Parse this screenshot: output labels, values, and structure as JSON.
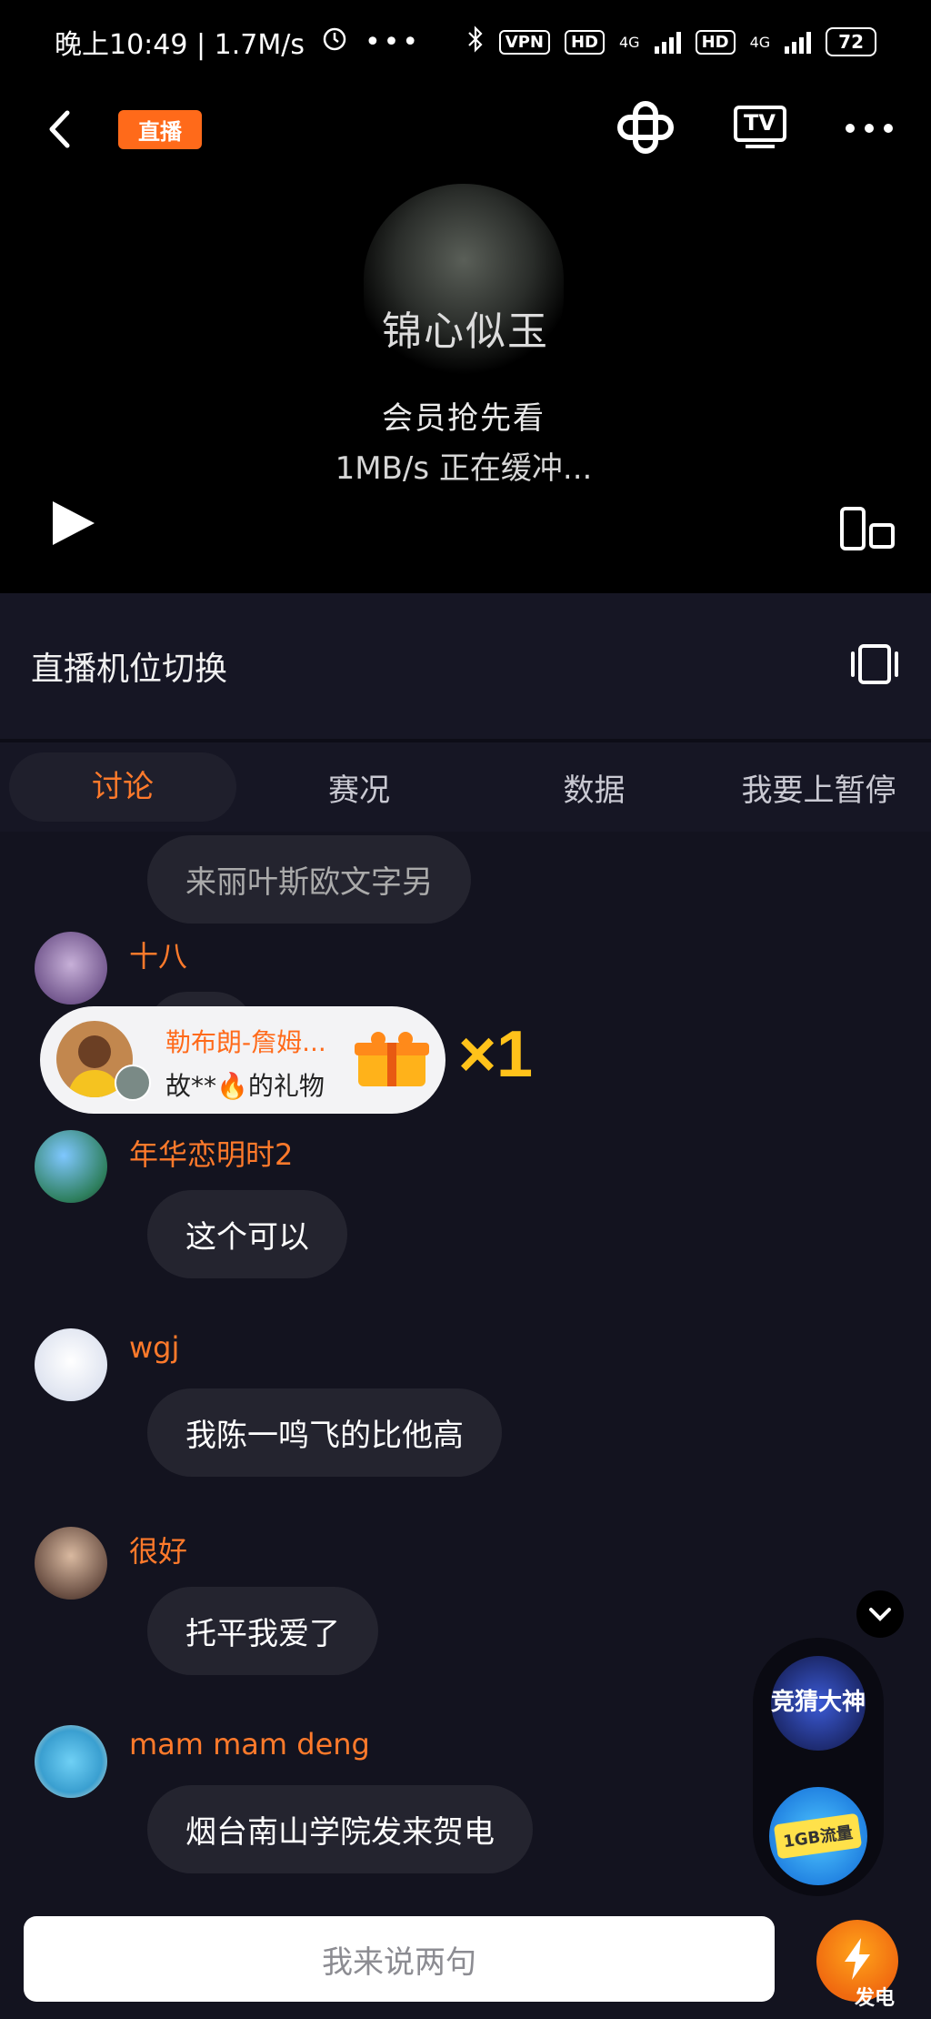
{
  "status": {
    "time": "晚上10:49 | 1.7M/s",
    "vpn": "VPN",
    "hd1": "HD",
    "net1": "4G",
    "hd2": "HD",
    "net2": "4G",
    "battery": "72"
  },
  "player": {
    "live_badge": "直播",
    "poster_title": "锦心似玉",
    "poster_subtitle": "会员抢先看",
    "buffer_text": "1MB/s 正在缓冲...",
    "tv_label": "TV"
  },
  "camera": {
    "label": "直播机位切换"
  },
  "tabs": [
    {
      "label": "讨论",
      "active": true
    },
    {
      "label": "赛况",
      "active": false
    },
    {
      "label": "数据",
      "active": false
    },
    {
      "label": "我要上暂停",
      "active": false
    }
  ],
  "chat": [
    {
      "user": "",
      "text": "来丽叶斯欧文字另"
    },
    {
      "user": "十八",
      "text": "…"
    },
    {
      "user": "年华恋明时2",
      "text": "这个可以"
    },
    {
      "user": "wgj",
      "text": "我陈一鸣飞的比他高"
    },
    {
      "user": "很好",
      "text": "托平我爱了"
    },
    {
      "user": "mam mam deng",
      "text": "烟台南山学院发来贺电"
    }
  ],
  "gift": {
    "sender": "勒布朗-詹姆...",
    "desc": "故**🔥的礼物",
    "count": "×1"
  },
  "widget": {
    "guess_label": "竞猜大神",
    "data_label": "1GB流量"
  },
  "bottom": {
    "input_placeholder": "我来说两句",
    "charge_label": "发电"
  },
  "colors": {
    "accent": "#ff7a2b",
    "background": "#13131f",
    "gift_count": "#ffc21a"
  }
}
